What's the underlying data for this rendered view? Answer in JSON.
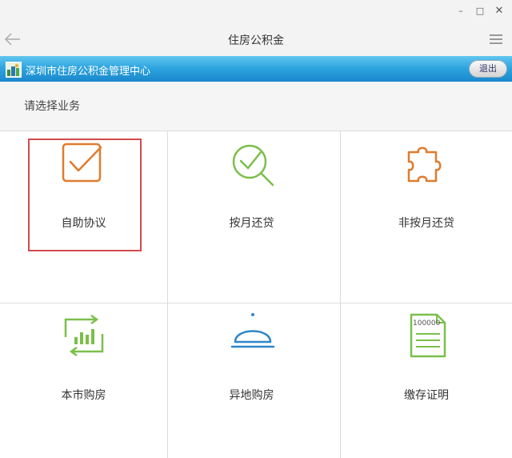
{
  "window": {
    "minimize_icon": "minimize-icon",
    "maximize_icon": "maximize-icon",
    "close_icon": "close-icon",
    "minimize_glyph": "–",
    "maximize_glyph": "□",
    "close_glyph": "✕"
  },
  "header": {
    "title": "住房公积金",
    "back_icon": "back-arrow-icon",
    "menu_icon": "hamburger-menu-icon"
  },
  "banner": {
    "text": "深圳市住房公积金管理中心",
    "logout_label": "退出",
    "logo_icon": "center-logo-icon"
  },
  "section": {
    "prompt": "请选择业务"
  },
  "services": [
    {
      "label": "自助协议",
      "icon": "checkbox-icon",
      "color": "#e07b2e"
    },
    {
      "label": "按月还贷",
      "icon": "search-check-icon",
      "color": "#7bbf4b"
    },
    {
      "label": "非按月还贷",
      "icon": "puzzle-icon",
      "color": "#e07b2e"
    },
    {
      "label": "本市购房",
      "icon": "chart-refresh-icon",
      "color": "#7bbf4b"
    },
    {
      "label": "异地购房",
      "icon": "service-bell-icon",
      "color": "#2f86c8"
    },
    {
      "label": "缴存证明",
      "icon": "document-icon",
      "color": "#7bbf4b",
      "icon_text": "100000"
    }
  ],
  "colors": {
    "banner": "#2fa6df",
    "highlight": "#d24a4a",
    "orange": "#e07b2e",
    "green": "#7bbf4b",
    "blue": "#2f86c8"
  }
}
